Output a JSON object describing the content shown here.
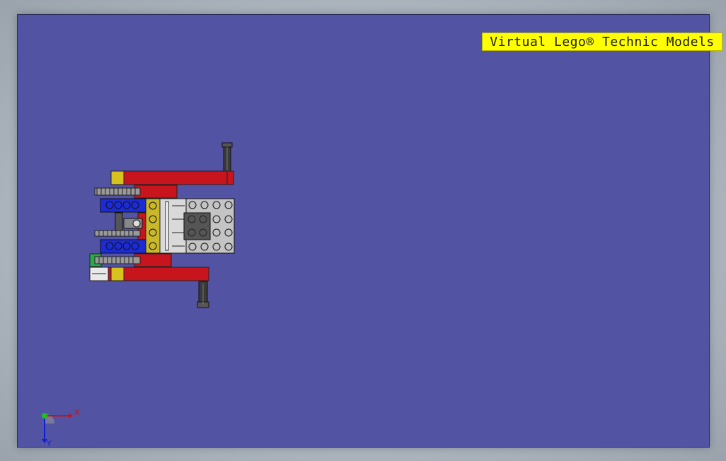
{
  "banner": {
    "text": "Virtual Lego® Technic Models"
  },
  "triad": {
    "x_label": "X",
    "y_label": "Y"
  },
  "colors": {
    "background": "#5253a3",
    "banner": "#ffff00",
    "beam_red": "#c8141c",
    "beam_blue": "#1b2bd6",
    "beam_yellow": "#c9b82a",
    "beam_green": "#2aa84a",
    "plate_gray": "#cfcfcf"
  },
  "icons": [
    "coordinate-triad-icon"
  ]
}
